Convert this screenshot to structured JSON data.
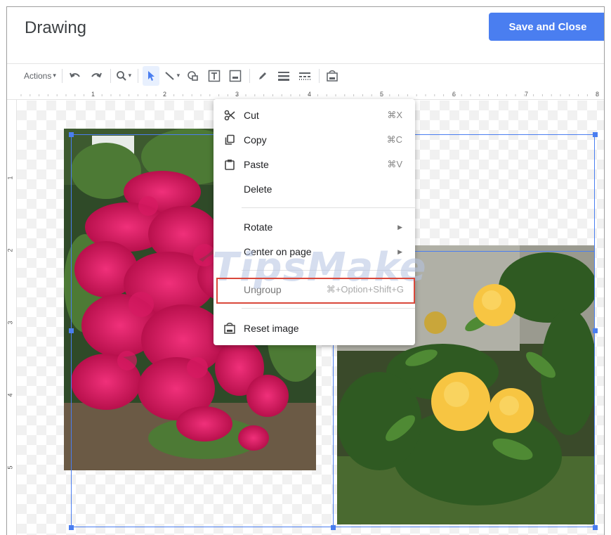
{
  "header": {
    "title": "Drawing",
    "save_label": "Save and Close"
  },
  "toolbar": {
    "actions_label": "Actions",
    "items": [
      "undo-icon",
      "redo-icon",
      "zoom-icon",
      "select-icon",
      "line-icon",
      "shape-icon",
      "textbox-icon",
      "image-icon",
      "pen-icon",
      "line-weight-icon",
      "line-dash-icon",
      "reset-image-icon"
    ]
  },
  "ruler": {
    "h_numbers": [
      "1",
      "2",
      "3",
      "4",
      "5",
      "6",
      "7",
      "8"
    ],
    "v_numbers": [
      "1",
      "2",
      "3",
      "4",
      "5"
    ]
  },
  "context_menu": {
    "cut": {
      "label": "Cut",
      "shortcut": "⌘X"
    },
    "copy": {
      "label": "Copy",
      "shortcut": "⌘C"
    },
    "paste": {
      "label": "Paste",
      "shortcut": "⌘V"
    },
    "delete": {
      "label": "Delete"
    },
    "rotate": {
      "label": "Rotate"
    },
    "center": {
      "label": "Center on page"
    },
    "ungroup": {
      "label": "Ungroup",
      "shortcut": "⌘+Option+Shift+G"
    },
    "reset": {
      "label": "Reset image"
    }
  },
  "watermark": "TipsMake",
  "colors": {
    "accent": "#4a7ef0",
    "highlight": "#d9483b"
  }
}
